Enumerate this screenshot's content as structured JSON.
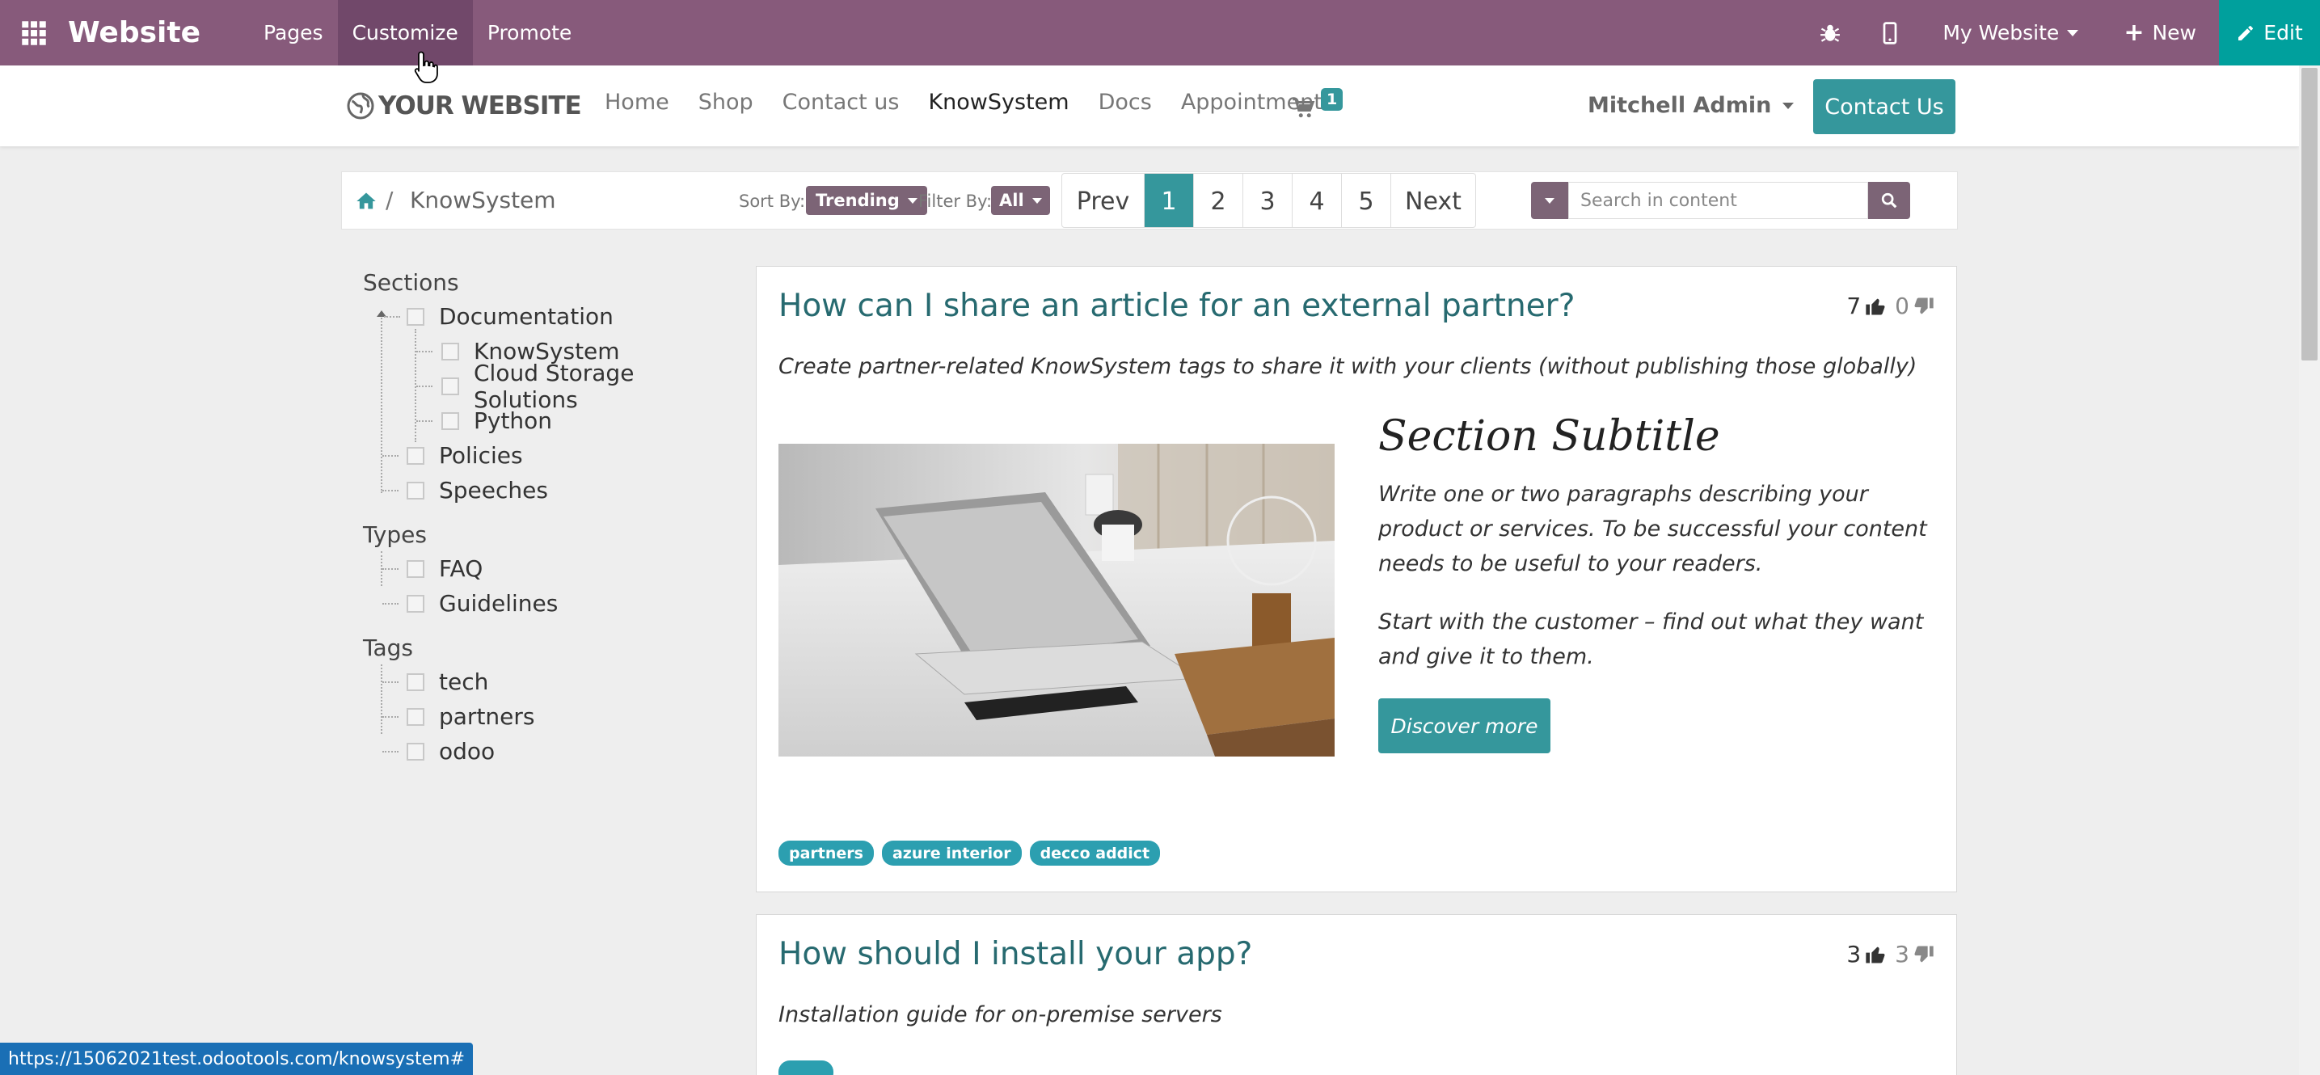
{
  "topbar": {
    "brand": "Website",
    "menu": [
      "Pages",
      "Customize",
      "Promote"
    ],
    "my_website": "My Website",
    "new_label": "New",
    "edit_label": "Edit"
  },
  "navbar": {
    "logo": "YOUR WEBSITE",
    "links": [
      "Home",
      "Shop",
      "Contact us",
      "KnowSystem",
      "Docs",
      "Appointments"
    ],
    "cart_count": "1",
    "user": "Mitchell Admin",
    "contact_button": "Contact Us"
  },
  "filterbar": {
    "breadcrumb_sep": "/",
    "breadcrumb_current": "KnowSystem",
    "sort_label": "Sort By:",
    "sort_value": "Trending",
    "filter_label": "Filter By:",
    "filter_value": "All",
    "pager": [
      "Prev",
      "1",
      "2",
      "3",
      "4",
      "5",
      "Next"
    ],
    "search_placeholder": "Search in content"
  },
  "sidebar": {
    "sections_title": "Sections",
    "sections": [
      "Documentation",
      "KnowSystem",
      "Cloud Storage Solutions",
      "Python",
      "Policies",
      "Speeches"
    ],
    "types_title": "Types",
    "types": [
      "FAQ",
      "Guidelines"
    ],
    "tags_title": "Tags",
    "tags": [
      "tech",
      "partners",
      "odoo"
    ]
  },
  "articles": [
    {
      "title": "How can I share an article for an external partner?",
      "likes": "7",
      "dislikes": "0",
      "summary": "Create partner-related KnowSystem tags to share it with your clients (without publishing those globally)",
      "subtitle": "Section Subtitle",
      "para1": "Write one or two paragraphs describing your product or services. To be successful your content needs to be useful to your readers.",
      "para2": "Start with the customer – find out what they want and give it to them.",
      "button": "Discover more",
      "tags": [
        "partners",
        "azure interior",
        "decco addict"
      ]
    },
    {
      "title": "How should I install your app?",
      "likes": "3",
      "dislikes": "3",
      "summary": "Installation guide for on-premise servers"
    }
  ],
  "status_url": "https://15062021test.odootools.com/knowsystem#",
  "colors": {
    "admin_bar": "#875a7b",
    "accent": "#35979c",
    "edit": "#00a09d",
    "tag": "#2c9fb0"
  }
}
